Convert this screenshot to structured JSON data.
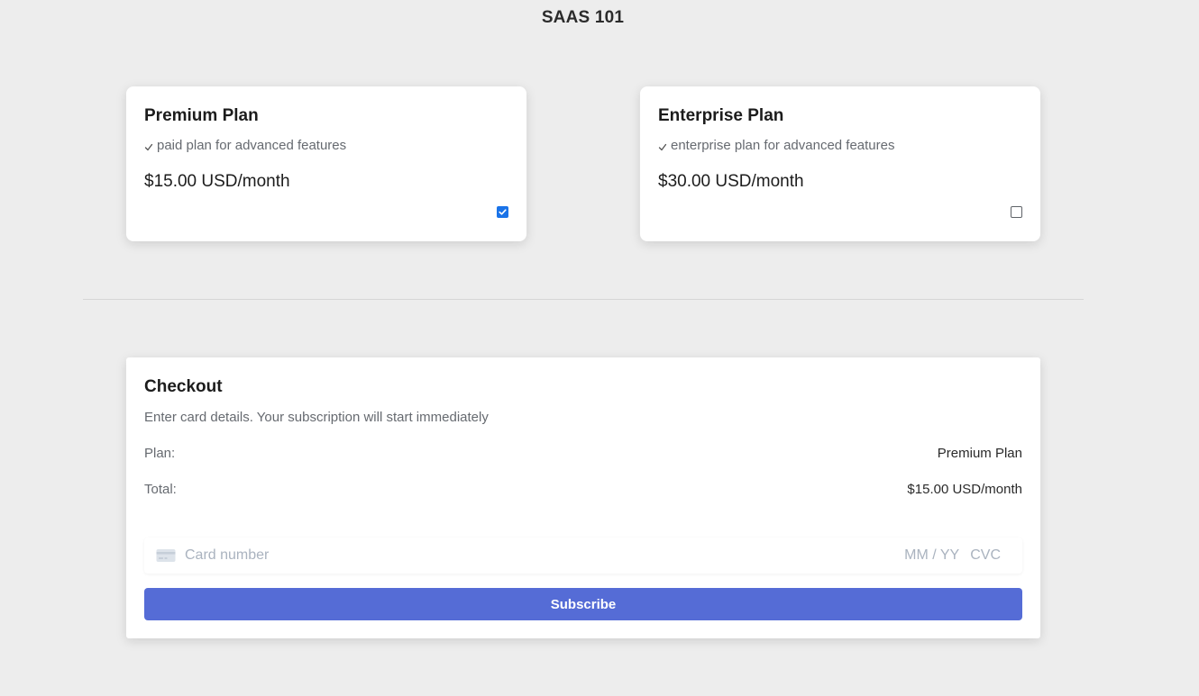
{
  "app": {
    "title": "SAAS 101"
  },
  "plans": [
    {
      "name": "Premium Plan",
      "description": "paid plan for advanced features",
      "price": "$15.00 USD/month",
      "selected": true
    },
    {
      "name": "Enterprise Plan",
      "description": "enterprise plan for advanced features",
      "price": "$30.00 USD/month",
      "selected": false
    }
  ],
  "checkout": {
    "title": "Checkout",
    "subtitle": "Enter card details. Your subscription will start immediately",
    "plan_label": "Plan:",
    "plan_value": "Premium Plan",
    "total_label": "Total:",
    "total_value": "$15.00 USD/month",
    "card_number_placeholder": "Card number",
    "expiry_placeholder": "MM / YY",
    "cvc_placeholder": "CVC",
    "subscribe_label": "Subscribe"
  },
  "colors": {
    "accent": "#556cd6",
    "checkbox": "#1a73e8",
    "background": "#ededed"
  },
  "icons": {
    "check": "check-icon",
    "card": "credit-card-icon"
  }
}
